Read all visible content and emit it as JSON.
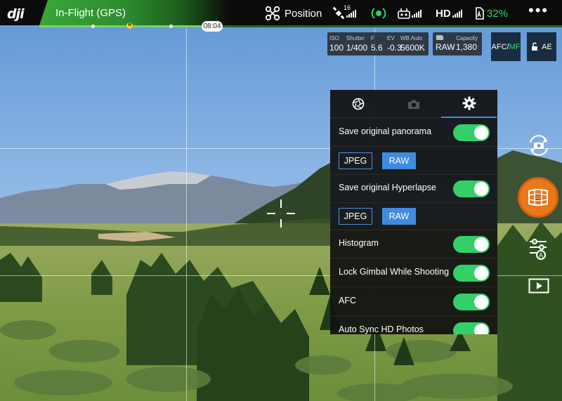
{
  "app": {
    "logo": "dji"
  },
  "status": {
    "flight_mode": "In-Flight (GPS)",
    "flight_time": "08:04",
    "home_marker": "H",
    "position_mode": "Position",
    "gps_satellites": "16",
    "video_link": "HD",
    "battery_percent": "32%",
    "more": "•••"
  },
  "camera": {
    "params": [
      {
        "label": "ISO",
        "value": "100"
      },
      {
        "label": "Shutter",
        "value": "1/400"
      },
      {
        "label": "F",
        "value": "5.6"
      },
      {
        "label": "EV",
        "value": "-0.3"
      },
      {
        "label": "WB Auto",
        "value": "5600K"
      }
    ],
    "storage": {
      "label": "Capacity",
      "format": "RAW",
      "capacity": "1,380"
    },
    "focus": {
      "afc": "AFC",
      "separator": "/",
      "mf": "MF"
    },
    "ae_lock": "AE"
  },
  "panel": {
    "tabs": [
      "aperture-icon",
      "camera-icon",
      "gear-icon"
    ],
    "active_tab": 2,
    "rows": [
      {
        "label": "Save original panorama",
        "on": true
      },
      {
        "label": "Save original Hyperlapse",
        "on": true
      },
      {
        "label": "Histogram",
        "on": true
      },
      {
        "label": "Lock Gimbal While Shooting",
        "on": true
      },
      {
        "label": "AFC",
        "on": true
      },
      {
        "label": "Auto Sync HD Photos",
        "on": true
      }
    ],
    "format_options": {
      "jpeg": "JPEG",
      "raw": "RAW",
      "selected": "RAW"
    }
  },
  "colors": {
    "accent_blue": "#3f8be0",
    "toggle_green": "#35cf6a",
    "battery_green": "#35d46a",
    "shutter_orange": "#e8791b",
    "status_green": "#3aa63a"
  }
}
